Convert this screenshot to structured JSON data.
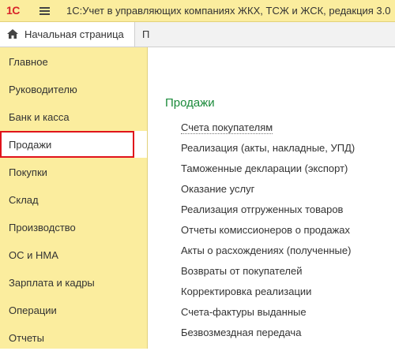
{
  "titlebar": {
    "logo_text": "1С",
    "app_title": "1С:Учет в управляющих компаниях ЖКХ, ТСЖ и ЖСК, редакция 3.0",
    "logo_color": "#d8232a"
  },
  "tabs": {
    "home_label": "Начальная страница",
    "next_label": "П",
    "home_icon": "home-icon"
  },
  "sidebar": {
    "active_index": 3,
    "items": [
      {
        "label": "Главное"
      },
      {
        "label": "Руководителю"
      },
      {
        "label": "Банк и касса"
      },
      {
        "label": "Продажи"
      },
      {
        "label": "Покупки"
      },
      {
        "label": "Склад"
      },
      {
        "label": "Производство"
      },
      {
        "label": "ОС и НМА"
      },
      {
        "label": "Зарплата и кадры"
      },
      {
        "label": "Операции"
      },
      {
        "label": "Отчеты"
      }
    ]
  },
  "main": {
    "section_title": "Продажи",
    "section_title_color": "#1a8a3a",
    "links": [
      {
        "label": "Счета покупателям"
      },
      {
        "label": "Реализация (акты, накладные, УПД)"
      },
      {
        "label": "Таможенные декларации (экспорт)"
      },
      {
        "label": "Оказание услуг"
      },
      {
        "label": "Реализация отгруженных товаров"
      },
      {
        "label": "Отчеты комиссионеров о продажах"
      },
      {
        "label": "Акты о расхождениях (полученные)"
      },
      {
        "label": "Возвраты от покупателей"
      },
      {
        "label": "Корректировка реализации"
      },
      {
        "label": "Счета-фактуры выданные"
      },
      {
        "label": "Безвозмездная передача"
      }
    ]
  },
  "colors": {
    "sidebar_bg": "#fbed9e",
    "highlight_border": "#e0131b"
  }
}
